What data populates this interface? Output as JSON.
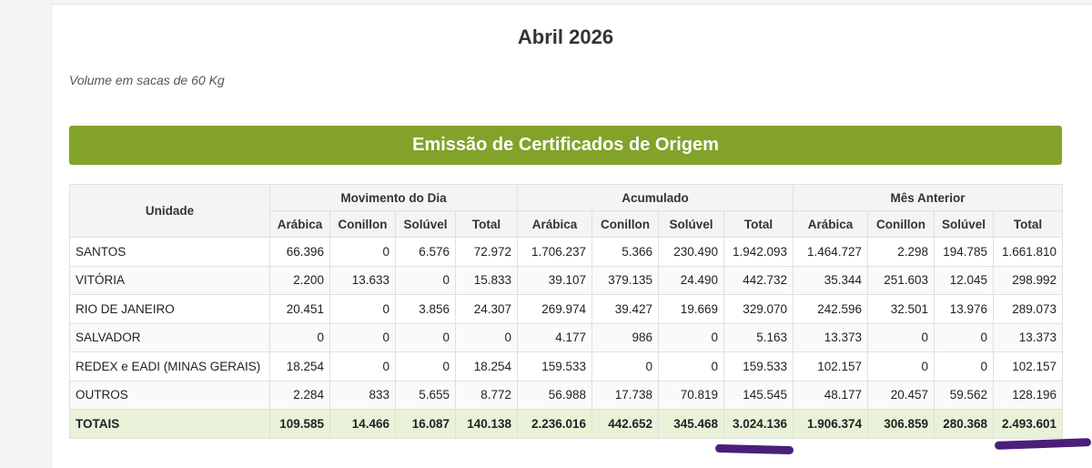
{
  "header": {
    "title": "Abril 2026",
    "subtitle": "Volume em sacas de 60 Kg",
    "banner": "Emissão de Certificados de Origem"
  },
  "table": {
    "unit_header": "Unidade",
    "groups": [
      "Movimento do Dia",
      "Acumulado",
      "Mês Anterior"
    ],
    "subheaders": [
      "Arábica",
      "Conillon",
      "Solúvel",
      "Total"
    ],
    "rows": [
      {
        "unit": "SANTOS",
        "values": [
          "66.396",
          "0",
          "6.576",
          "72.972",
          "1.706.237",
          "5.366",
          "230.490",
          "1.942.093",
          "1.464.727",
          "2.298",
          "194.785",
          "1.661.810"
        ]
      },
      {
        "unit": "VITÓRIA",
        "values": [
          "2.200",
          "13.633",
          "0",
          "15.833",
          "39.107",
          "379.135",
          "24.490",
          "442.732",
          "35.344",
          "251.603",
          "12.045",
          "298.992"
        ]
      },
      {
        "unit": "RIO DE JANEIRO",
        "values": [
          "20.451",
          "0",
          "3.856",
          "24.307",
          "269.974",
          "39.427",
          "19.669",
          "329.070",
          "242.596",
          "32.501",
          "13.976",
          "289.073"
        ]
      },
      {
        "unit": "SALVADOR",
        "values": [
          "0",
          "0",
          "0",
          "0",
          "4.177",
          "986",
          "0",
          "5.163",
          "13.373",
          "0",
          "0",
          "13.373"
        ]
      },
      {
        "unit": "REDEX e EADI (MINAS GERAIS)",
        "values": [
          "18.254",
          "0",
          "0",
          "18.254",
          "159.533",
          "0",
          "0",
          "159.533",
          "102.157",
          "0",
          "0",
          "102.157"
        ]
      },
      {
        "unit": "OUTROS",
        "values": [
          "2.284",
          "833",
          "5.655",
          "8.772",
          "56.988",
          "17.738",
          "70.819",
          "145.545",
          "48.177",
          "20.457",
          "59.562",
          "128.196"
        ]
      }
    ],
    "totals": {
      "unit": "TOTAIS",
      "values": [
        "109.585",
        "14.466",
        "16.087",
        "140.138",
        "2.236.016",
        "442.652",
        "345.468",
        "3.024.136",
        "1.906.374",
        "306.859",
        "280.368",
        "2.493.601"
      ]
    }
  },
  "colors": {
    "banner": "#83a22a",
    "totals_row": "#e9f2d9",
    "annotation": "#4b1e7a"
  }
}
